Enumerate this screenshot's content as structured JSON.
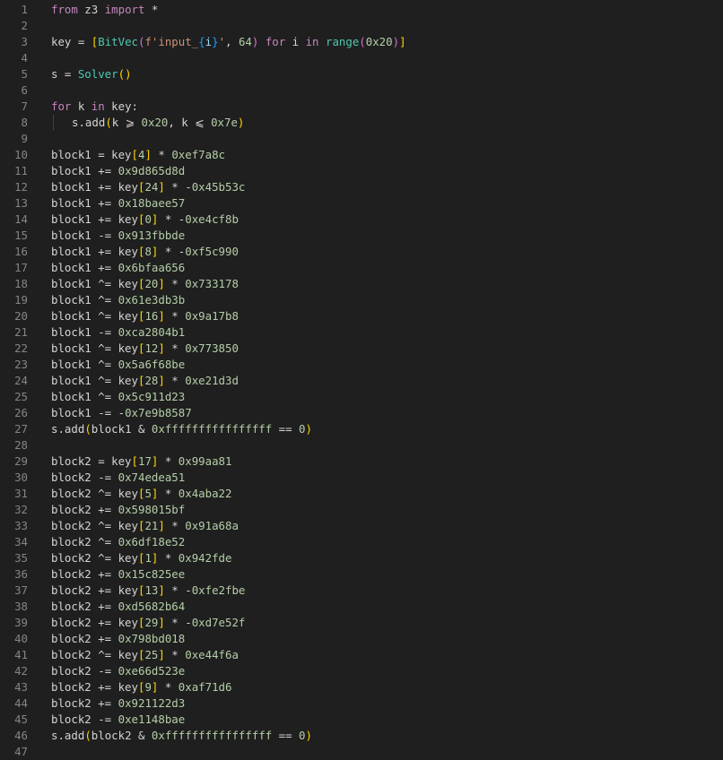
{
  "editor": {
    "language": "python",
    "colors": {
      "background": "#1f1f1f",
      "line_number": "#858585",
      "keyword": "#c586c0",
      "function": "#dcdcaa",
      "class": "#4ec9b0",
      "number": "#b5cea8",
      "string": "#ce9178",
      "bracket_level1": "#ffd700",
      "bracket_level2": "#da70d6",
      "bracket_level3": "#179fff"
    },
    "lines": [
      {
        "n": "1",
        "tokens": [
          [
            "kw",
            "from"
          ],
          [
            "plain",
            " z3 "
          ],
          [
            "kw",
            "import"
          ],
          [
            "plain",
            " *"
          ]
        ]
      },
      {
        "n": "2",
        "tokens": []
      },
      {
        "n": "3",
        "tokens": [
          [
            "plain",
            "key = "
          ],
          [
            "b1",
            "["
          ],
          [
            "cls",
            "BitVec"
          ],
          [
            "b2",
            "("
          ],
          [
            "str",
            "f'input_"
          ],
          [
            "b3",
            "{"
          ],
          [
            "var",
            "i"
          ],
          [
            "b3",
            "}"
          ],
          [
            "str",
            "'"
          ],
          [
            "plain",
            ", "
          ],
          [
            "num",
            "64"
          ],
          [
            "b2",
            ")"
          ],
          [
            "plain",
            " "
          ],
          [
            "kw",
            "for"
          ],
          [
            "plain",
            " i "
          ],
          [
            "kw",
            "in"
          ],
          [
            "plain",
            " "
          ],
          [
            "cls",
            "range"
          ],
          [
            "b2",
            "("
          ],
          [
            "num",
            "0x20"
          ],
          [
            "b2",
            ")"
          ],
          [
            "b1",
            "]"
          ]
        ]
      },
      {
        "n": "4",
        "tokens": []
      },
      {
        "n": "5",
        "tokens": [
          [
            "plain",
            "s = "
          ],
          [
            "cls",
            "Solver"
          ],
          [
            "b1",
            "()"
          ]
        ]
      },
      {
        "n": "6",
        "tokens": []
      },
      {
        "n": "7",
        "tokens": [
          [
            "kw",
            "for"
          ],
          [
            "plain",
            " k "
          ],
          [
            "kw",
            "in"
          ],
          [
            "plain",
            " key:"
          ]
        ]
      },
      {
        "n": "8",
        "indent": true,
        "tokens": [
          [
            "plain",
            "s.add"
          ],
          [
            "b1",
            "("
          ],
          [
            "plain",
            "k ⩾ "
          ],
          [
            "num",
            "0x20"
          ],
          [
            "plain",
            ", k ⩽ "
          ],
          [
            "num",
            "0x7e"
          ],
          [
            "b1",
            ")"
          ]
        ]
      },
      {
        "n": "9",
        "tokens": []
      },
      {
        "n": "10",
        "tokens": [
          [
            "plain",
            "block1 = key"
          ],
          [
            "b1",
            "["
          ],
          [
            "num",
            "4"
          ],
          [
            "b1",
            "]"
          ],
          [
            "plain",
            " * "
          ],
          [
            "num",
            "0xef7a8c"
          ]
        ]
      },
      {
        "n": "11",
        "tokens": [
          [
            "plain",
            "block1 += "
          ],
          [
            "num",
            "0x9d865d8d"
          ]
        ]
      },
      {
        "n": "12",
        "tokens": [
          [
            "plain",
            "block1 += key"
          ],
          [
            "b1",
            "["
          ],
          [
            "num",
            "24"
          ],
          [
            "b1",
            "]"
          ],
          [
            "plain",
            " * -"
          ],
          [
            "num",
            "0x45b53c"
          ]
        ]
      },
      {
        "n": "13",
        "tokens": [
          [
            "plain",
            "block1 += "
          ],
          [
            "num",
            "0x18baee57"
          ]
        ]
      },
      {
        "n": "14",
        "tokens": [
          [
            "plain",
            "block1 += key"
          ],
          [
            "b1",
            "["
          ],
          [
            "num",
            "0"
          ],
          [
            "b1",
            "]"
          ],
          [
            "plain",
            " * -"
          ],
          [
            "num",
            "0xe4cf8b"
          ]
        ]
      },
      {
        "n": "15",
        "tokens": [
          [
            "plain",
            "block1 -= "
          ],
          [
            "num",
            "0x913fbbde"
          ]
        ]
      },
      {
        "n": "16",
        "tokens": [
          [
            "plain",
            "block1 += key"
          ],
          [
            "b1",
            "["
          ],
          [
            "num",
            "8"
          ],
          [
            "b1",
            "]"
          ],
          [
            "plain",
            " * -"
          ],
          [
            "num",
            "0xf5c990"
          ]
        ]
      },
      {
        "n": "17",
        "tokens": [
          [
            "plain",
            "block1 += "
          ],
          [
            "num",
            "0x6bfaa656"
          ]
        ]
      },
      {
        "n": "18",
        "tokens": [
          [
            "plain",
            "block1 ^= key"
          ],
          [
            "b1",
            "["
          ],
          [
            "num",
            "20"
          ],
          [
            "b1",
            "]"
          ],
          [
            "plain",
            " * "
          ],
          [
            "num",
            "0x733178"
          ]
        ]
      },
      {
        "n": "19",
        "tokens": [
          [
            "plain",
            "block1 ^= "
          ],
          [
            "num",
            "0x61e3db3b"
          ]
        ]
      },
      {
        "n": "20",
        "tokens": [
          [
            "plain",
            "block1 ^= key"
          ],
          [
            "b1",
            "["
          ],
          [
            "num",
            "16"
          ],
          [
            "b1",
            "]"
          ],
          [
            "plain",
            " * "
          ],
          [
            "num",
            "0x9a17b8"
          ]
        ]
      },
      {
        "n": "21",
        "tokens": [
          [
            "plain",
            "block1 -= "
          ],
          [
            "num",
            "0xca2804b1"
          ]
        ]
      },
      {
        "n": "22",
        "tokens": [
          [
            "plain",
            "block1 ^= key"
          ],
          [
            "b1",
            "["
          ],
          [
            "num",
            "12"
          ],
          [
            "b1",
            "]"
          ],
          [
            "plain",
            " * "
          ],
          [
            "num",
            "0x773850"
          ]
        ]
      },
      {
        "n": "23",
        "tokens": [
          [
            "plain",
            "block1 ^= "
          ],
          [
            "num",
            "0x5a6f68be"
          ]
        ]
      },
      {
        "n": "24",
        "tokens": [
          [
            "plain",
            "block1 ^= key"
          ],
          [
            "b1",
            "["
          ],
          [
            "num",
            "28"
          ],
          [
            "b1",
            "]"
          ],
          [
            "plain",
            " * "
          ],
          [
            "num",
            "0xe21d3d"
          ]
        ]
      },
      {
        "n": "25",
        "tokens": [
          [
            "plain",
            "block1 ^= "
          ],
          [
            "num",
            "0x5c911d23"
          ]
        ]
      },
      {
        "n": "26",
        "tokens": [
          [
            "plain",
            "block1 -= -"
          ],
          [
            "num",
            "0x7e9b8587"
          ]
        ]
      },
      {
        "n": "27",
        "tokens": [
          [
            "plain",
            "s.add"
          ],
          [
            "b1",
            "("
          ],
          [
            "plain",
            "block1 & "
          ],
          [
            "num",
            "0xffffffffffffffff"
          ],
          [
            "plain",
            " == "
          ],
          [
            "num",
            "0"
          ],
          [
            "b1",
            ")"
          ]
        ]
      },
      {
        "n": "28",
        "tokens": []
      },
      {
        "n": "29",
        "tokens": [
          [
            "plain",
            "block2 = key"
          ],
          [
            "b1",
            "["
          ],
          [
            "num",
            "17"
          ],
          [
            "b1",
            "]"
          ],
          [
            "plain",
            " * "
          ],
          [
            "num",
            "0x99aa81"
          ]
        ]
      },
      {
        "n": "30",
        "tokens": [
          [
            "plain",
            "block2 -= "
          ],
          [
            "num",
            "0x74edea51"
          ]
        ]
      },
      {
        "n": "31",
        "tokens": [
          [
            "plain",
            "block2 ^= key"
          ],
          [
            "b1",
            "["
          ],
          [
            "num",
            "5"
          ],
          [
            "b1",
            "]"
          ],
          [
            "plain",
            " * "
          ],
          [
            "num",
            "0x4aba22"
          ]
        ]
      },
      {
        "n": "32",
        "tokens": [
          [
            "plain",
            "block2 += "
          ],
          [
            "num",
            "0x598015bf"
          ]
        ]
      },
      {
        "n": "33",
        "tokens": [
          [
            "plain",
            "block2 ^= key"
          ],
          [
            "b1",
            "["
          ],
          [
            "num",
            "21"
          ],
          [
            "b1",
            "]"
          ],
          [
            "plain",
            " * "
          ],
          [
            "num",
            "0x91a68a"
          ]
        ]
      },
      {
        "n": "34",
        "tokens": [
          [
            "plain",
            "block2 ^= "
          ],
          [
            "num",
            "0x6df18e52"
          ]
        ]
      },
      {
        "n": "35",
        "tokens": [
          [
            "plain",
            "block2 ^= key"
          ],
          [
            "b1",
            "["
          ],
          [
            "num",
            "1"
          ],
          [
            "b1",
            "]"
          ],
          [
            "plain",
            " * "
          ],
          [
            "num",
            "0x942fde"
          ]
        ]
      },
      {
        "n": "36",
        "tokens": [
          [
            "plain",
            "block2 += "
          ],
          [
            "num",
            "0x15c825ee"
          ]
        ]
      },
      {
        "n": "37",
        "tokens": [
          [
            "plain",
            "block2 += key"
          ],
          [
            "b1",
            "["
          ],
          [
            "num",
            "13"
          ],
          [
            "b1",
            "]"
          ],
          [
            "plain",
            " * -"
          ],
          [
            "num",
            "0xfe2fbe"
          ]
        ]
      },
      {
        "n": "38",
        "tokens": [
          [
            "plain",
            "block2 += "
          ],
          [
            "num",
            "0xd5682b64"
          ]
        ]
      },
      {
        "n": "39",
        "tokens": [
          [
            "plain",
            "block2 += key"
          ],
          [
            "b1",
            "["
          ],
          [
            "num",
            "29"
          ],
          [
            "b1",
            "]"
          ],
          [
            "plain",
            " * -"
          ],
          [
            "num",
            "0xd7e52f"
          ]
        ]
      },
      {
        "n": "40",
        "tokens": [
          [
            "plain",
            "block2 += "
          ],
          [
            "num",
            "0x798bd018"
          ]
        ]
      },
      {
        "n": "41",
        "tokens": [
          [
            "plain",
            "block2 ^= key"
          ],
          [
            "b1",
            "["
          ],
          [
            "num",
            "25"
          ],
          [
            "b1",
            "]"
          ],
          [
            "plain",
            " * "
          ],
          [
            "num",
            "0xe44f6a"
          ]
        ]
      },
      {
        "n": "42",
        "tokens": [
          [
            "plain",
            "block2 -= "
          ],
          [
            "num",
            "0xe66d523e"
          ]
        ]
      },
      {
        "n": "43",
        "tokens": [
          [
            "plain",
            "block2 += key"
          ],
          [
            "b1",
            "["
          ],
          [
            "num",
            "9"
          ],
          [
            "b1",
            "]"
          ],
          [
            "plain",
            " * "
          ],
          [
            "num",
            "0xaf71d6"
          ]
        ]
      },
      {
        "n": "44",
        "tokens": [
          [
            "plain",
            "block2 += "
          ],
          [
            "num",
            "0x921122d3"
          ]
        ]
      },
      {
        "n": "45",
        "tokens": [
          [
            "plain",
            "block2 -= "
          ],
          [
            "num",
            "0xe1148bae"
          ]
        ]
      },
      {
        "n": "46",
        "tokens": [
          [
            "plain",
            "s.add"
          ],
          [
            "b1",
            "("
          ],
          [
            "plain",
            "block2 & "
          ],
          [
            "num",
            "0xffffffffffffffff"
          ],
          [
            "plain",
            " == "
          ],
          [
            "num",
            "0"
          ],
          [
            "b1",
            ")"
          ]
        ]
      },
      {
        "n": "47",
        "tokens": []
      }
    ]
  }
}
